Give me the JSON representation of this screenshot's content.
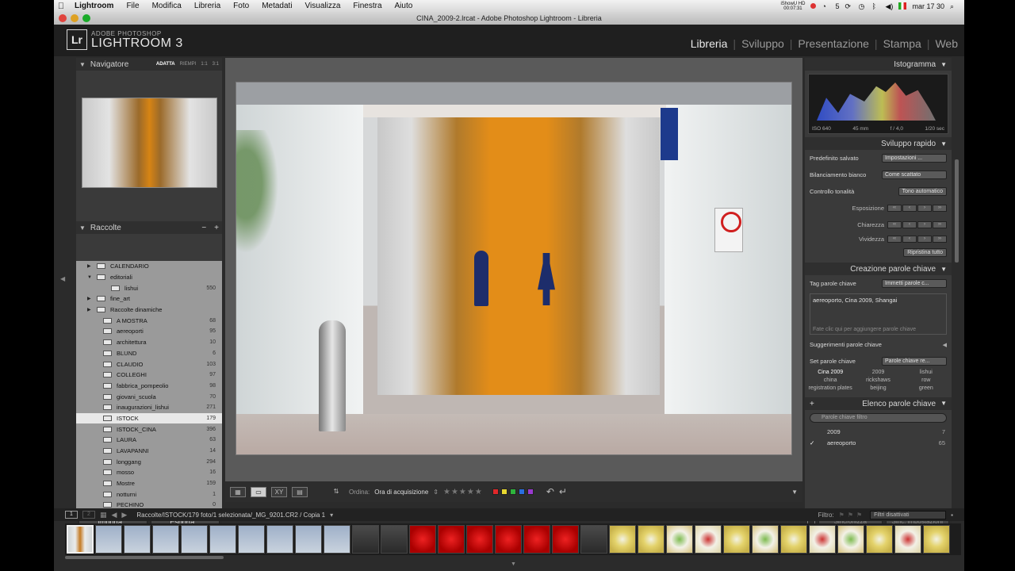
{
  "menubar": {
    "app_name": "Lightroom",
    "items": [
      "File",
      "Modifica",
      "Libreria",
      "Foto",
      "Metadati",
      "Visualizza",
      "Finestra",
      "Aiuto"
    ],
    "status_text": "iShowU HD",
    "status_time_small": "00:07:31",
    "clock": "mar 17 30",
    "battery_num": "5"
  },
  "window": {
    "title": "CINA_2009-2.lrcat - Adobe Photoshop Lightroom - Libreria"
  },
  "identity": {
    "logo": "Lr",
    "brand_small": "ADOBE PHOTOSHOP",
    "brand_large": "LIGHTROOM 3"
  },
  "modules": [
    "Libreria",
    "Sviluppo",
    "Presentazione",
    "Stampa",
    "Web"
  ],
  "navigator": {
    "title": "Navigatore",
    "options": [
      "ADATTA",
      "RIEMPI",
      "1:1",
      "3:1"
    ]
  },
  "collections": {
    "title": "Raccolte",
    "actions": [
      "−",
      "+"
    ],
    "rows": [
      {
        "name": "CALENDARIO",
        "count": ""
      },
      {
        "name": "editoriali",
        "count": ""
      },
      {
        "name": "lishui",
        "count": "550"
      },
      {
        "name": "fine_art",
        "count": ""
      },
      {
        "name": "Raccolte dinamiche",
        "count": ""
      },
      {
        "name": "A MOSTRA",
        "count": "68"
      },
      {
        "name": "aereoporti",
        "count": "95"
      },
      {
        "name": "architettura",
        "count": "10"
      },
      {
        "name": "BLUND",
        "count": "6"
      },
      {
        "name": "CLAUDIO",
        "count": "103"
      },
      {
        "name": "COLLEGHI",
        "count": "97"
      },
      {
        "name": "fabbrica_pompeolio",
        "count": "98"
      },
      {
        "name": "giovani_scuola",
        "count": "70"
      },
      {
        "name": "inaugurazioni_lishui",
        "count": "271"
      },
      {
        "name": "ISTOCK",
        "count": "179"
      },
      {
        "name": "ISTOCK_CINA",
        "count": "396"
      },
      {
        "name": "LAURA",
        "count": "63"
      },
      {
        "name": "LAVAPANNI",
        "count": "14"
      },
      {
        "name": "longgang",
        "count": "294"
      },
      {
        "name": "mosso",
        "count": "16"
      },
      {
        "name": "Mostre",
        "count": "159"
      },
      {
        "name": "notturni",
        "count": "1"
      },
      {
        "name": "PECHINO",
        "count": "0"
      }
    ]
  },
  "left_buttons": {
    "import": "Importa...",
    "export": "Esporta..."
  },
  "toolbar": {
    "sort_label": "Ordina:",
    "sort_value": "Ora di acquisizione",
    "stars": "★★★★★"
  },
  "colors": {
    "red": "#e0282a",
    "yellow": "#e8d830",
    "green": "#2eb43c",
    "blue": "#2a6ee0",
    "purple": "#9a3ad0"
  },
  "histogram": {
    "title": "Istogramma",
    "iso": "ISO 640",
    "focal": "45 mm",
    "aperture": "f / 4,0",
    "shutter": "1/20 sec"
  },
  "quick_develop": {
    "title": "Sviluppo rapido",
    "preset_label": "Predefinito salvato",
    "preset_value": "Impostazioni ...",
    "wb_label": "Bilanciamento bianco",
    "wb_value": "Come scattato",
    "tone_label": "Controllo tonalità",
    "tone_button": "Tono automatico",
    "exposure": "Esposizione",
    "clarity": "Chiarezza",
    "vibrance": "Vividezza",
    "reset": "Ripristina tutto"
  },
  "keywording": {
    "title": "Creazione parole chiave",
    "tag_label": "Tag parole chiave",
    "tag_value": "Immetti parole c...",
    "keywords_text": "aereoporto, Cina 2009, Shangai",
    "hint": "Fate clic qui per aggiungere parole chiave",
    "suggestions_label": "Suggerimenti parole chiave",
    "set_label": "Set parole chiave",
    "set_value": "Parole chiave re...",
    "set_keywords": [
      "Cina 2009",
      "2009",
      "lishui",
      "china",
      "rickshaws",
      "row",
      "registration plates",
      "beijing",
      "green"
    ]
  },
  "keyword_list": {
    "title": "Elenco parole chiave",
    "plus": "+",
    "search_placeholder": "Parole chiave filtro",
    "rows": [
      {
        "check": "",
        "name": "2009",
        "count": "7"
      },
      {
        "check": "✓",
        "name": "aereoporto",
        "count": "65"
      }
    ]
  },
  "right_buttons": {
    "sync": "Sincronizza",
    "sync_settings": "Sinc. impostazioni"
  },
  "filmstrip": {
    "page1": "1",
    "page2": "2",
    "path": "Raccolte/ISTOCK/179 foto/1 selezionata/_MG_9201.CR2 / Copia 1",
    "filter_label": "Filtro:",
    "filter_value": "Filtri disattivati"
  }
}
